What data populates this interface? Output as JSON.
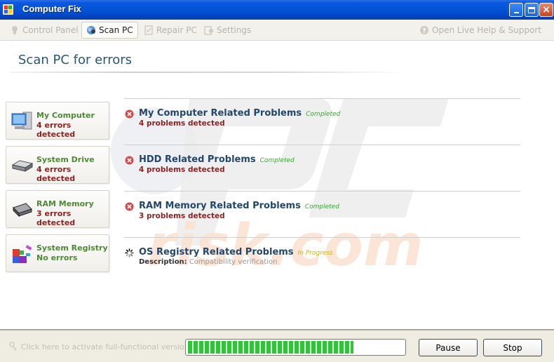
{
  "window": {
    "title": "Computer Fix",
    "controls": {
      "minimize": "minimize",
      "maximize": "maximize",
      "close": "×"
    }
  },
  "toolbar": {
    "items": [
      {
        "label": "Control Panel",
        "icon": "control-panel-icon",
        "active": false
      },
      {
        "label": "Scan PC",
        "icon": "scan-icon",
        "active": true
      },
      {
        "label": "Repair PC",
        "icon": "repair-icon",
        "active": false
      },
      {
        "label": "Settings",
        "icon": "settings-icon",
        "active": false
      }
    ],
    "help": {
      "label": "Open Live Help & Support",
      "icon": "help-icon"
    }
  },
  "page": {
    "title": "Scan PC for errors"
  },
  "categories": [
    {
      "name": "My Computer",
      "status": "4 errors detected",
      "icon": "computer-icon",
      "has_errors": true
    },
    {
      "name": "System Drive",
      "status": "4 errors detected",
      "icon": "hard-drive-icon",
      "has_errors": true
    },
    {
      "name": "RAM Memory",
      "status": "3 errors detected",
      "icon": "ram-chip-icon",
      "has_errors": true
    },
    {
      "name": "System Registry",
      "status": "No errors",
      "icon": "registry-icon",
      "has_errors": false
    }
  ],
  "results": [
    {
      "title": "My Computer Related Problems",
      "state": "Completed",
      "detail": "4 problems detected",
      "icon": "error-icon"
    },
    {
      "title": "HDD Related Problems",
      "state": "Completed",
      "detail": "4 problems detected",
      "icon": "error-icon"
    },
    {
      "title": "RAM Memory Related Problems",
      "state": "Completed",
      "detail": "3 problems detected",
      "icon": "error-icon"
    },
    {
      "title": "OS Registry Related Problems",
      "state": "In Progress",
      "description_label": "Description:",
      "description_value": "Compatibility verification",
      "icon": "spinner-icon"
    }
  ],
  "footer": {
    "activate_label": "Click here to activate full-functional version",
    "progress_percent": 77,
    "pause_label": "Pause",
    "stop_label": "Stop"
  },
  "colors": {
    "titlebar": "#0354d8",
    "category_name": "#4d8a36",
    "error_text": "#8e2323",
    "result_title": "#23476b",
    "completed": "#3fa23a",
    "in_progress": "#c9b21a",
    "progress_fill": "#2fc43a"
  }
}
